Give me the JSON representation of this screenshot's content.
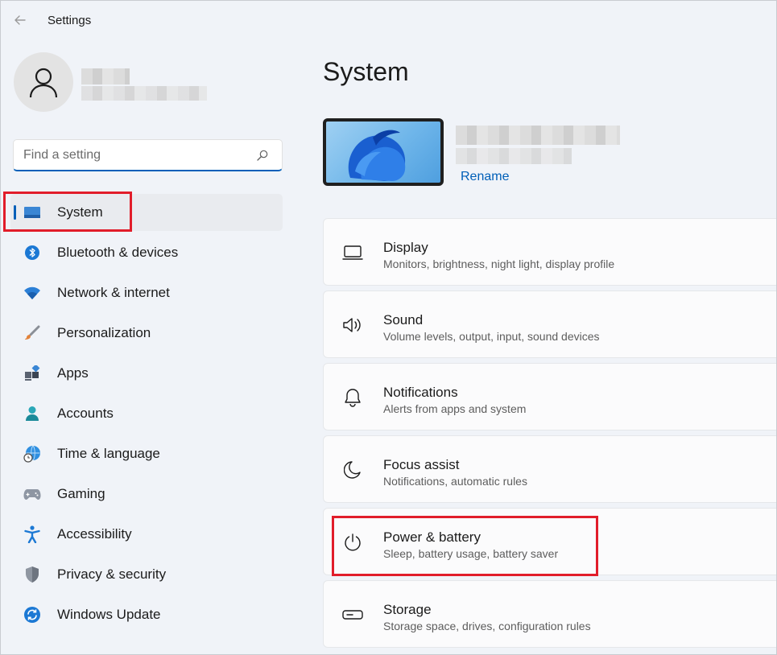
{
  "window": {
    "title": "Settings",
    "back_icon": "back-arrow-icon"
  },
  "profile": {
    "avatar_icon": "user-icon"
  },
  "search": {
    "placeholder": "Find a setting",
    "icon": "search-icon"
  },
  "sidebar": {
    "items": [
      {
        "label": "System",
        "icon": "system-display-icon",
        "selected": true
      },
      {
        "label": "Bluetooth & devices",
        "icon": "bluetooth-icon"
      },
      {
        "label": "Network & internet",
        "icon": "wifi-icon"
      },
      {
        "label": "Personalization",
        "icon": "brush-icon"
      },
      {
        "label": "Apps",
        "icon": "apps-icon"
      },
      {
        "label": "Accounts",
        "icon": "accounts-icon"
      },
      {
        "label": "Time & language",
        "icon": "globe-clock-icon"
      },
      {
        "label": "Gaming",
        "icon": "gamepad-icon"
      },
      {
        "label": "Accessibility",
        "icon": "accessibility-icon"
      },
      {
        "label": "Privacy & security",
        "icon": "shield-icon"
      },
      {
        "label": "Windows Update",
        "icon": "update-icon"
      }
    ]
  },
  "main": {
    "title": "System",
    "rename_label": "Rename",
    "cards": [
      {
        "title": "Display",
        "subtitle": "Monitors, brightness, night light, display profile",
        "icon": "display-icon"
      },
      {
        "title": "Sound",
        "subtitle": "Volume levels, output, input, sound devices",
        "icon": "speaker-icon"
      },
      {
        "title": "Notifications",
        "subtitle": "Alerts from apps and system",
        "icon": "bell-icon"
      },
      {
        "title": "Focus assist",
        "subtitle": "Notifications, automatic rules",
        "icon": "moon-icon"
      },
      {
        "title": "Power & battery",
        "subtitle": "Sleep, battery usage, battery saver",
        "icon": "power-icon"
      },
      {
        "title": "Storage",
        "subtitle": "Storage space, drives, configuration rules",
        "icon": "storage-icon"
      }
    ]
  },
  "colors": {
    "accent": "#005fb8",
    "highlight": "#e11d2a"
  }
}
